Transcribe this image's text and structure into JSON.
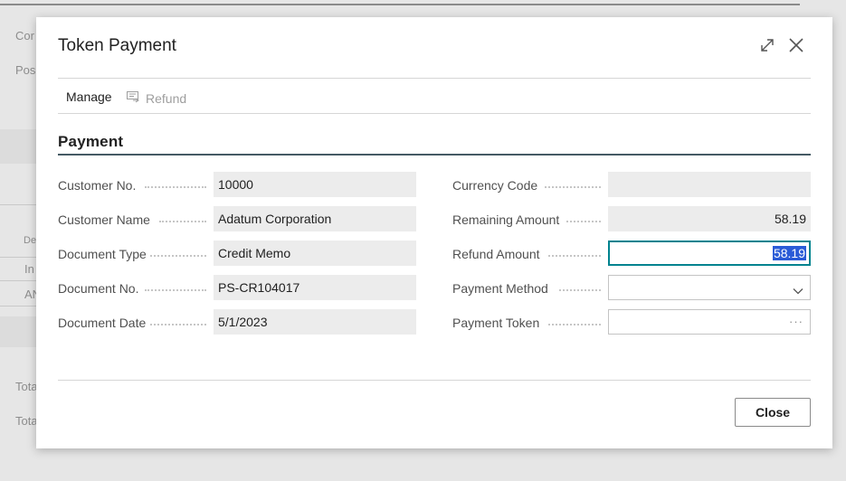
{
  "background": {
    "fragments": [
      "Cor",
      "Pos",
      "De",
      "In",
      "AN",
      "Tota",
      "Tota"
    ]
  },
  "dialog": {
    "title": "Token Payment",
    "icons": {
      "expand": "expand-icon",
      "close": "close-icon"
    },
    "actions": {
      "manage_label": "Manage",
      "refund_label": "Refund",
      "refund_icon": "refund-icon"
    },
    "section_title": "Payment",
    "left_fields": [
      {
        "label": "Customer No.",
        "value": "10000"
      },
      {
        "label": "Customer Name",
        "value": "Adatum Corporation"
      },
      {
        "label": "Document Type",
        "value": "Credit Memo"
      },
      {
        "label": "Document No.",
        "value": "PS-CR104017"
      },
      {
        "label": "Document Date",
        "value": "5/1/2023"
      }
    ],
    "right_fields": [
      {
        "label": "Currency Code",
        "value": ""
      },
      {
        "label": "Remaining Amount",
        "value": "58.19"
      },
      {
        "label": "Refund Amount",
        "value": "58.19"
      },
      {
        "label": "Payment Method",
        "value": ""
      },
      {
        "label": "Payment Token",
        "value": ""
      }
    ],
    "lookup_glyph": "···",
    "close_button": "Close"
  },
  "colors": {
    "accent": "#00838f",
    "selection": "#2a5bd7",
    "section_rule": "#455a64"
  }
}
